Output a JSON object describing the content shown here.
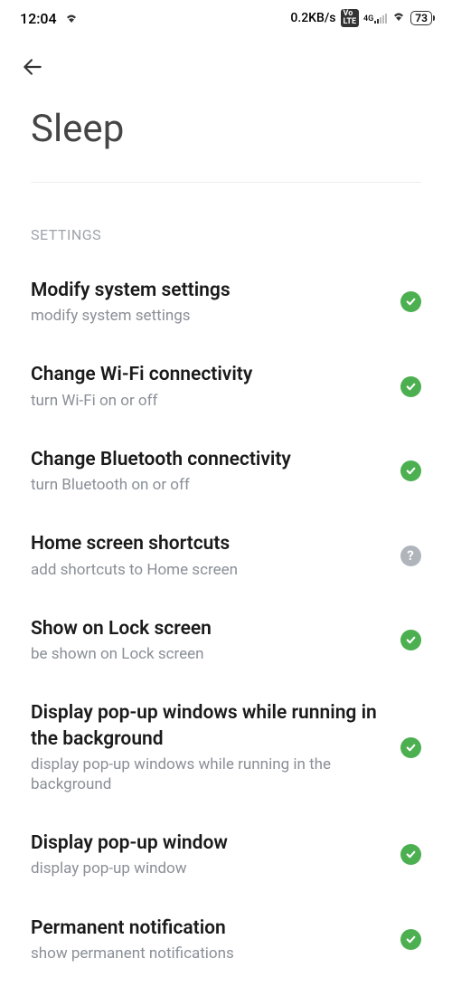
{
  "statusBar": {
    "time": "12:04",
    "dataRate": "0.2KB/s",
    "volte": "Vo LTE",
    "network": "4G",
    "battery": "73"
  },
  "pageTitle": "Sleep",
  "sectionHeader": "SETTINGS",
  "settings": [
    {
      "title": "Modify system settings",
      "desc": "modify system settings",
      "status": "allowed"
    },
    {
      "title": "Change Wi-Fi connectivity",
      "desc": "turn Wi-Fi on or off",
      "status": "allowed"
    },
    {
      "title": "Change Bluetooth connectivity",
      "desc": "turn Bluetooth on or off",
      "status": "allowed"
    },
    {
      "title": "Home screen shortcuts",
      "desc": "add shortcuts to Home screen",
      "status": "ask"
    },
    {
      "title": "Show on Lock screen",
      "desc": "be shown on Lock screen",
      "status": "allowed"
    },
    {
      "title": "Display pop-up windows while running in the background",
      "desc": "display pop-up windows while running in the background",
      "status": "allowed"
    },
    {
      "title": "Display pop-up window",
      "desc": "display pop-up window",
      "status": "allowed"
    },
    {
      "title": "Permanent notification",
      "desc": "show permanent notifications",
      "status": "allowed"
    }
  ]
}
